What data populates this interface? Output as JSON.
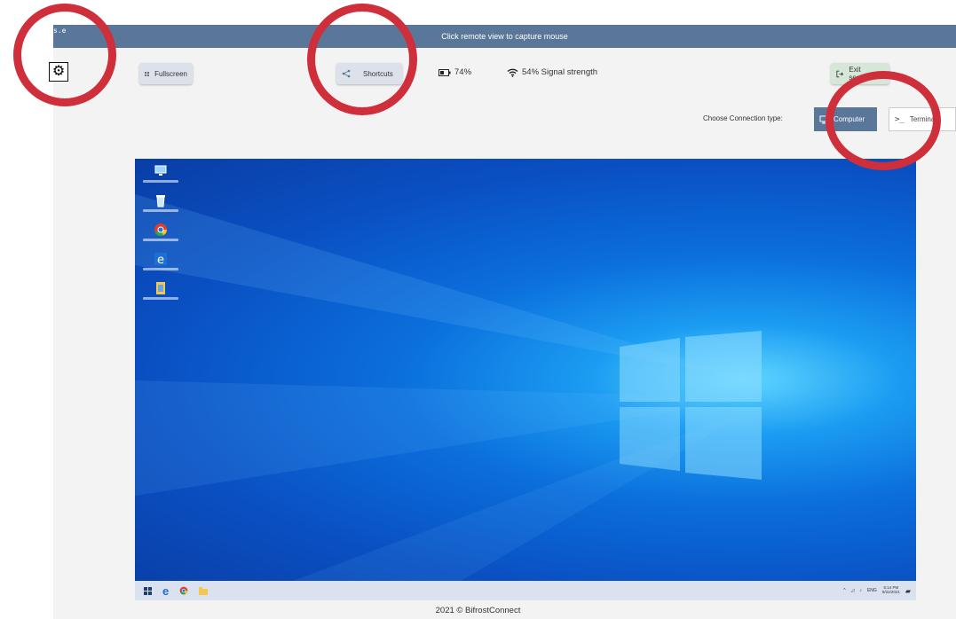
{
  "topbar": {
    "corner_text": "s.e",
    "message": "Click remote view to capture mouse"
  },
  "toolbar": {
    "fullscreen_label": "Fullscreen",
    "shortcuts_label": "Shortcuts",
    "battery_text": "74%",
    "signal_text": "54% Signal strength",
    "exit_label": "Exit session"
  },
  "connection": {
    "label": "Choose Connection type:",
    "computer_label": "Computer",
    "terminal_label": "Terminal"
  },
  "remote_desktop": {
    "icons": [
      {
        "icon": "this-pc-icon"
      },
      {
        "icon": "recycle-bin-icon"
      },
      {
        "icon": "chrome-icon"
      },
      {
        "icon": "edge-icon"
      },
      {
        "icon": "folder-icon"
      }
    ],
    "taskbar": {
      "lang": "ENG",
      "time": "5:14 PM",
      "date": "9/22/2021"
    }
  },
  "footer": {
    "text": "2021 © BifrostConnect"
  },
  "colors": {
    "header": "#5a7799",
    "annotation_ring": "#cf2f3a",
    "exit_button": "#d6e7da"
  }
}
